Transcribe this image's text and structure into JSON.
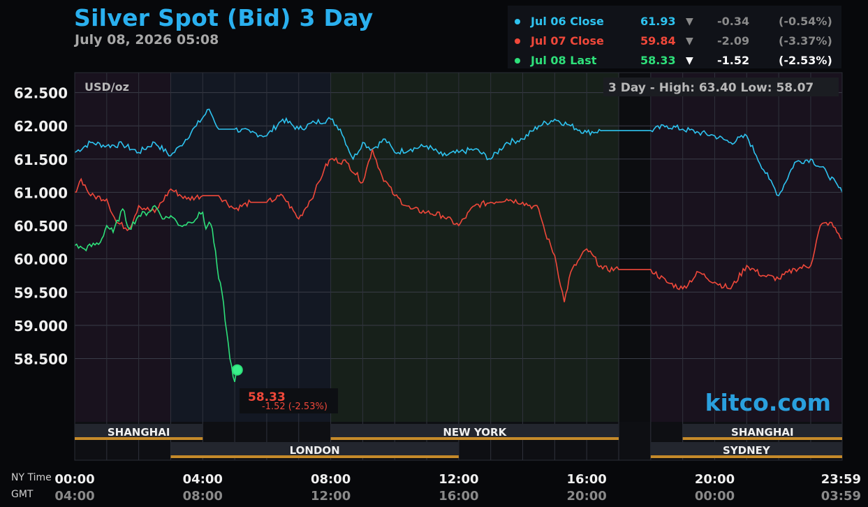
{
  "header": {
    "title": "Silver Spot (Bid) 3 Day",
    "subtitle": "July 08, 2026 05:08"
  },
  "legend": [
    {
      "name": "Jul 06 Close",
      "value": "61.93",
      "arrow": "▼",
      "change": "-0.34",
      "pct": "(-0.54%)",
      "color": "#2ec3f0",
      "arrow_color": "#8a8a8a",
      "text_color": "#8a8a8a"
    },
    {
      "name": "Jul 07 Close",
      "value": "59.84",
      "arrow": "▼",
      "change": "-2.09",
      "pct": "(-3.37%)",
      "color": "#f0483a",
      "arrow_color": "#8a8a8a",
      "text_color": "#8a8a8a"
    },
    {
      "name": "Jul 08 Last",
      "value": "58.33",
      "arrow": "▼",
      "change": "-1.52",
      "pct": "(-2.53%)",
      "color": "#2ee07a",
      "arrow_color": "#ffffff",
      "text_color": "#ffffff"
    }
  ],
  "plot": {
    "unit_label": "USD/oz",
    "stats_label": "3 Day - High: 63.40  Low: 58.07",
    "watermark": "kitco.com",
    "last_value": "58.33",
    "last_change": "-1.52 (-2.53%)"
  },
  "axis": {
    "y_ticks": [
      "62.500",
      "62.000",
      "61.500",
      "61.000",
      "60.500",
      "60.000",
      "59.500",
      "59.000",
      "58.500"
    ],
    "ny_label": "NY Time",
    "gmt_label": "GMT",
    "x_ticks_ny": [
      "00:00",
      "04:00",
      "08:00",
      "12:00",
      "16:00",
      "20:00",
      "23:59"
    ],
    "x_ticks_gmt": [
      "04:00",
      "08:00",
      "12:00",
      "16:00",
      "20:00",
      "00:00",
      "03:59"
    ]
  },
  "sessions": [
    {
      "name": "SHANGHAI",
      "start": 0.0,
      "end": 4.0,
      "row": 1
    },
    {
      "name": "NEW YORK",
      "start": 8.0,
      "end": 17.0,
      "row": 1
    },
    {
      "name": "SHANGHAI",
      "start": 19.0,
      "end": 23.983,
      "row": 1
    },
    {
      "name": "LONDON",
      "start": 3.0,
      "end": 12.0,
      "row": 2
    },
    {
      "name": "SYDNEY",
      "start": 18.0,
      "end": 23.983,
      "row": 2
    }
  ],
  "chart_data": {
    "type": "line",
    "title": "Silver Spot (Bid) 3 Day",
    "ylabel": "USD/oz",
    "xlabel": "NY Time",
    "x_unit": "hours (NY time)",
    "xlim": [
      0,
      23.983
    ],
    "ylim": [
      57.55,
      62.8
    ],
    "grid": true,
    "legend_position": "top-right",
    "series": [
      {
        "name": "Jul 06 Close",
        "color": "#2ec3f0",
        "x": [
          0,
          0.5,
          1,
          1.5,
          2,
          2.5,
          3,
          3.3,
          3.8,
          4.2,
          4.5,
          5,
          5.5,
          6,
          6.5,
          7,
          7.5,
          8,
          8.3,
          8.7,
          9,
          9.3,
          9.7,
          10,
          10.5,
          11,
          11.5,
          12,
          12.5,
          13,
          13.5,
          14,
          14.5,
          15,
          15.5,
          16,
          16.5,
          17,
          17.5,
          18,
          18.5,
          19,
          19.5,
          20,
          20.5,
          21,
          21.3,
          21.7,
          22,
          22.5,
          23,
          23.5,
          23.983
        ],
        "y": [
          61.6,
          61.75,
          61.7,
          61.72,
          61.6,
          61.75,
          61.55,
          61.7,
          62.0,
          62.25,
          61.95,
          61.95,
          61.9,
          61.85,
          62.1,
          61.95,
          62.05,
          62.1,
          61.95,
          61.5,
          61.75,
          61.65,
          61.8,
          61.6,
          61.65,
          61.7,
          61.55,
          61.6,
          61.65,
          61.5,
          61.75,
          61.8,
          62.0,
          62.1,
          62.0,
          61.9,
          61.93,
          61.93,
          61.93,
          61.93,
          62.0,
          61.95,
          61.9,
          61.85,
          61.75,
          61.85,
          61.55,
          61.2,
          60.95,
          61.45,
          61.5,
          61.3,
          61.0
        ]
      },
      {
        "name": "Jul 07 Close",
        "color": "#f0483a",
        "x": [
          0,
          0.2,
          0.5,
          1,
          1.3,
          1.7,
          2,
          2.5,
          3,
          3.5,
          4,
          4.5,
          5,
          5.5,
          6,
          6.5,
          7,
          7.5,
          7.8,
          8,
          8.5,
          9,
          9.3,
          9.6,
          10,
          10.5,
          11,
          11.5,
          12,
          12.5,
          13,
          13.5,
          14,
          14.5,
          14.7,
          15,
          15.3,
          15.5,
          16,
          16.5,
          17,
          17.5,
          18,
          18.5,
          19,
          19.5,
          20,
          20.5,
          21,
          21.5,
          22,
          22.5,
          23,
          23.3,
          23.6,
          23.983
        ],
        "y": [
          61.0,
          61.2,
          60.95,
          60.9,
          60.55,
          60.45,
          60.8,
          60.7,
          61.05,
          60.9,
          60.95,
          60.95,
          60.75,
          60.85,
          60.85,
          60.95,
          60.6,
          61.0,
          61.35,
          61.5,
          61.45,
          61.15,
          61.65,
          61.25,
          60.95,
          60.75,
          60.7,
          60.65,
          60.5,
          60.8,
          60.85,
          60.9,
          60.85,
          60.75,
          60.4,
          60.05,
          59.35,
          59.8,
          60.15,
          59.85,
          59.84,
          59.84,
          59.84,
          59.65,
          59.55,
          59.8,
          59.65,
          59.55,
          59.9,
          59.75,
          59.7,
          59.85,
          59.9,
          60.5,
          60.55,
          60.3
        ]
      },
      {
        "name": "Jul 08 Last",
        "color": "#2ee07a",
        "x": [
          0,
          0.3,
          0.8,
          1,
          1.2,
          1.5,
          1.7,
          2,
          2.3,
          2.5,
          2.8,
          3.0,
          3.3,
          3.6,
          4,
          4.1,
          4.2,
          4.3,
          4.5,
          4.6,
          4.75,
          4.85,
          5.0,
          5.08
        ],
        "y": [
          60.2,
          60.15,
          60.25,
          60.5,
          60.4,
          60.75,
          60.45,
          60.65,
          60.7,
          60.8,
          60.6,
          60.65,
          60.5,
          60.55,
          60.7,
          60.45,
          60.55,
          60.45,
          59.7,
          59.5,
          58.9,
          58.5,
          58.15,
          58.33
        ]
      }
    ]
  }
}
